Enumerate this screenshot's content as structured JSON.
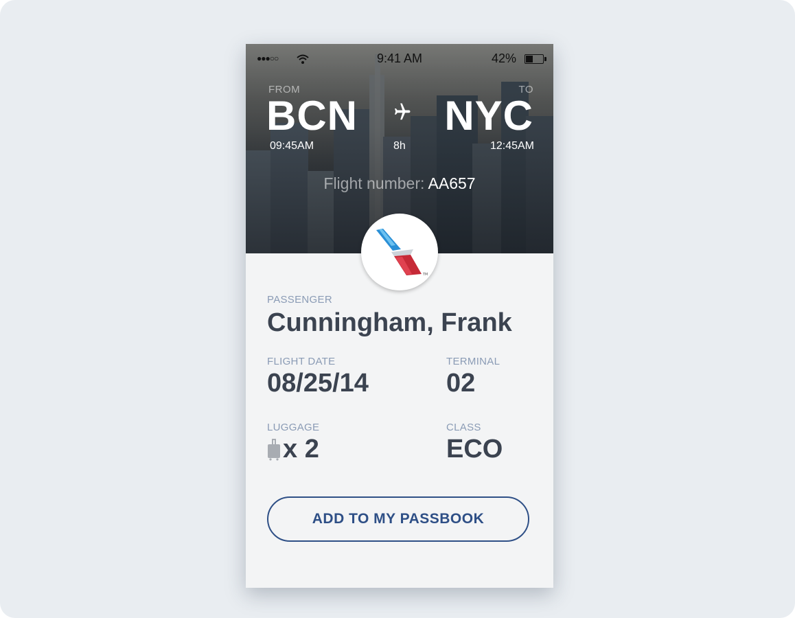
{
  "status_bar": {
    "signal": "●●●○○",
    "time": "9:41 AM",
    "battery_pct": "42%",
    "battery_level": 0.42
  },
  "route": {
    "from_label": "FROM",
    "to_label": "TO",
    "from_code": "BCN",
    "to_code": "NYC",
    "departure_time": "09:45AM",
    "duration": "8h",
    "arrival_time": "12:45AM",
    "flight_number_label": "Flight number:",
    "flight_number": "AA657"
  },
  "details": {
    "passenger_label": "PASSENGER",
    "passenger_name": "Cunningham, Frank",
    "flight_date_label": "FLIGHT DATE",
    "flight_date": "08/25/14",
    "terminal_label": "TERMINAL",
    "terminal": "02",
    "luggage_label": "LUGGAGE",
    "luggage": "x 2",
    "class_label": "CLASS",
    "class": "ECO"
  },
  "cta": {
    "label": "ADD TO MY PASSBOOK"
  },
  "colors": {
    "background": "#e9edf1",
    "card": "#f3f4f5",
    "accent": "#2e4f86",
    "label": "#8a9bb5",
    "value": "#3b4350",
    "logo_blue": "#2a8fd6",
    "logo_red": "#c62a37"
  },
  "icons": {
    "wifi": "wifi-icon",
    "battery": "battery-icon",
    "plane": "airplane-icon",
    "logo": "airline-logo",
    "luggage": "suitcase-icon"
  }
}
